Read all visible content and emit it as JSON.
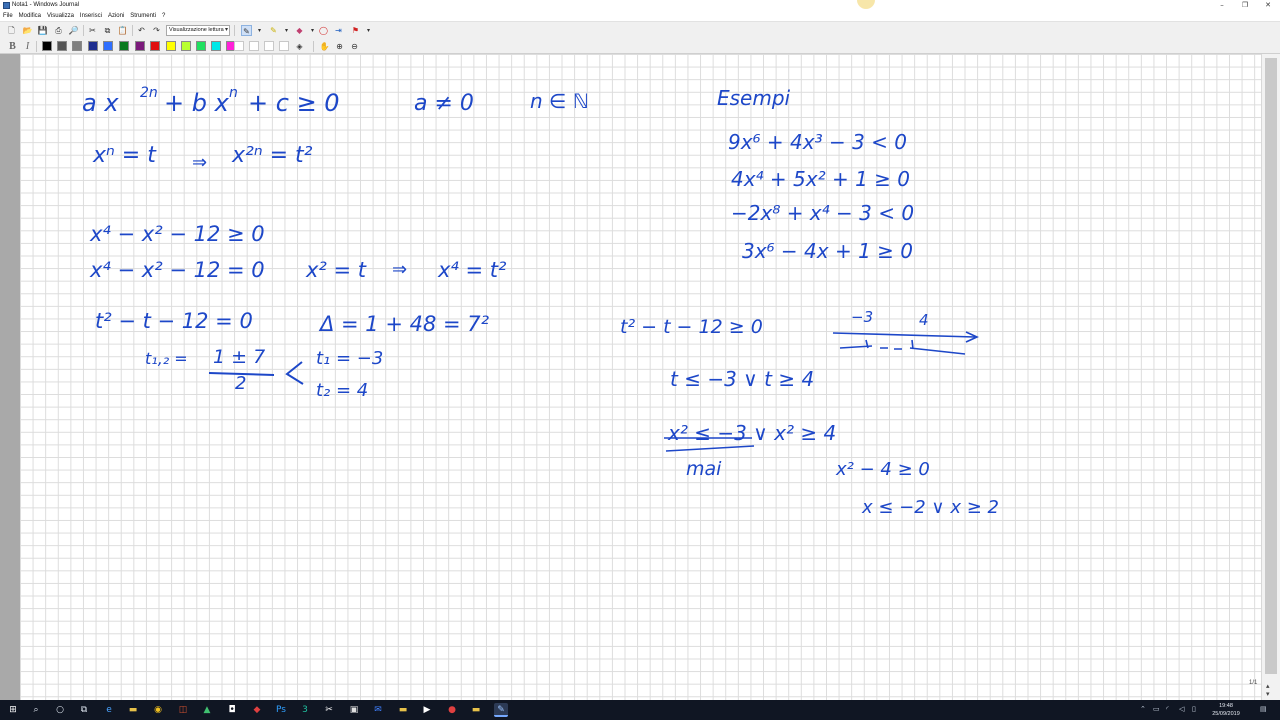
{
  "window": {
    "title": "Nota1 - Windows Journal",
    "minimize": "–",
    "maximize": "❐",
    "close": "✕"
  },
  "menu": [
    "File",
    "Modifica",
    "Visualizza",
    "Inserisci",
    "Azioni",
    "Strumenti",
    "?"
  ],
  "toolbar": {
    "view_mode": "Visualizzazione lettura",
    "colors": [
      "#000000",
      "#555555",
      "#808080",
      "#1e2d8f",
      "#2f6fff",
      "#0a7a1e",
      "#7a1a7a",
      "#e01010",
      "#f58a0c",
      "#ffff00",
      "#b8ff30",
      "#20e060",
      "#00e8e8",
      "#ff20d8"
    ]
  },
  "note": {
    "line1": [
      "a x",
      "2n",
      "+ b x",
      "n",
      "+ c ≥ 0",
      "a ≠ 0",
      "n ∈ ℕ"
    ],
    "line2": [
      "xⁿ = t",
      "⇒",
      "x²ⁿ = t²"
    ],
    "ex1": [
      "x⁴ − x² − 12 ≥ 0",
      "x⁴ − x² − 12 = 0",
      "x² = t",
      "⇒",
      "x⁴ = t²"
    ],
    "ex1_sub": [
      "t² − t − 12 = 0",
      "Δ = 1 + 48 = 7²"
    ],
    "roots": [
      "t₁,₂ =",
      "1 ± 7",
      "2",
      "t₁ = −3",
      "t₂ = 4"
    ],
    "esempi_title": "Esempi",
    "esempi": [
      "9x⁶ + 4x³ − 3 < 0",
      "4x⁴ + 5x² + 1 ≥ 0",
      "−2x⁸ + x⁴ − 3 < 0",
      "3x⁶ − 4x + 1 ≥ 0"
    ],
    "solution": [
      "t² − t − 12 ≥ 0",
      "−3",
      "4",
      "t ≤ −3 ∨ t ≥ 4",
      "x² ≤ −3 ∨ x² ≥ 4",
      "mai",
      "x² − 4 ≥ 0",
      "x ≤ −2 ∨ x ≥ 2"
    ]
  },
  "status": {
    "page": "1/1",
    "time": "19:48",
    "date": "25/09/2019"
  }
}
